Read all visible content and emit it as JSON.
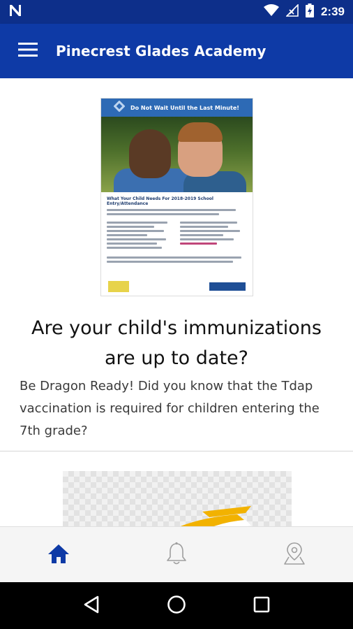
{
  "status_bar": {
    "time": "2:39",
    "icons": [
      "n-logo-icon",
      "wifi-icon",
      "no-signal-icon",
      "battery-charging-icon"
    ]
  },
  "app_bar": {
    "title": "Pinecrest Glades Academy",
    "menu_icon": "hamburger-menu-icon",
    "background": "#0e3aa6"
  },
  "post": {
    "flyer": {
      "banner": "Do Not Wait Until the Last Minute!",
      "subheading": "What Your Child Needs For 2018-2019 School Entry/Attendance"
    },
    "headline": "Are your child's immunizations are up to date?",
    "body": "Be Dragon Ready! Did you know that the Tdap vaccination is required for children entering the 7th grade?"
  },
  "bottom_nav": {
    "items": [
      {
        "name": "home",
        "icon": "home-icon",
        "active": true
      },
      {
        "name": "notifications",
        "icon": "bell-icon",
        "active": false
      },
      {
        "name": "location",
        "icon": "map-pin-icon",
        "active": false
      }
    ],
    "active_color": "#0e3aa6",
    "inactive_color": "#9e9e9e"
  },
  "system_nav": {
    "icons": [
      "back-icon",
      "home-circle-icon",
      "recents-icon"
    ]
  }
}
